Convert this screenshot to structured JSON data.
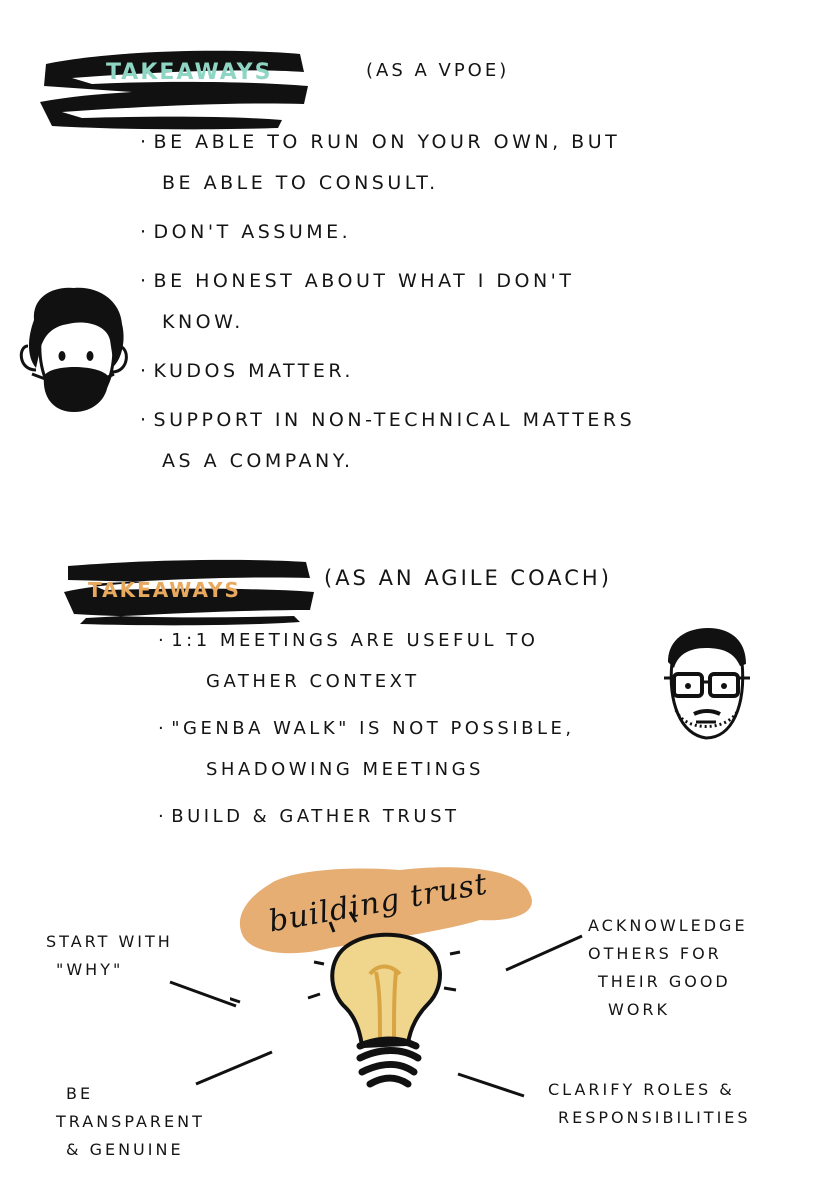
{
  "section_vpoe": {
    "heading": "Takeaways",
    "subheading": "(as a VPoE)",
    "items": [
      {
        "line1": "Be able to run on your own, but",
        "line2": "be able to consult."
      },
      {
        "line1": "Don't assume.",
        "line2": ""
      },
      {
        "line1": "Be honest about what I don't",
        "line2": "know."
      },
      {
        "line1": "Kudos matter.",
        "line2": ""
      },
      {
        "line1": "Support in non-technical matters",
        "line2": "as a company."
      }
    ]
  },
  "section_coach": {
    "heading": "Takeaways",
    "subheading": "(as an agile coach)",
    "items": [
      {
        "line1": "1:1 meetings are useful to",
        "line2": "gather context"
      },
      {
        "line1": "\"Genba walk\" is not possible,",
        "line2": "shadowing meetings"
      },
      {
        "line1": "Build & gather trust",
        "line2": ""
      }
    ]
  },
  "trust": {
    "title": "building trust",
    "tips": {
      "top_left": {
        "line1": "Start with",
        "line2": "\"why\""
      },
      "top_right": {
        "line1": "Acknowledge",
        "line2": "others for",
        "line3": "their good",
        "line4": "work"
      },
      "bottom_left": {
        "line1": "Be",
        "line2": "transparent",
        "line3": "& genuine"
      },
      "bottom_right": {
        "line1": "Clarify roles &",
        "line2": "responsibilities"
      }
    }
  },
  "colors": {
    "ink": "#111111",
    "teal_heading": "#8fd5c4",
    "orange_heading": "#e8a95e",
    "cloud": "#e7ae73",
    "bulb_fill": "#efd68c"
  }
}
